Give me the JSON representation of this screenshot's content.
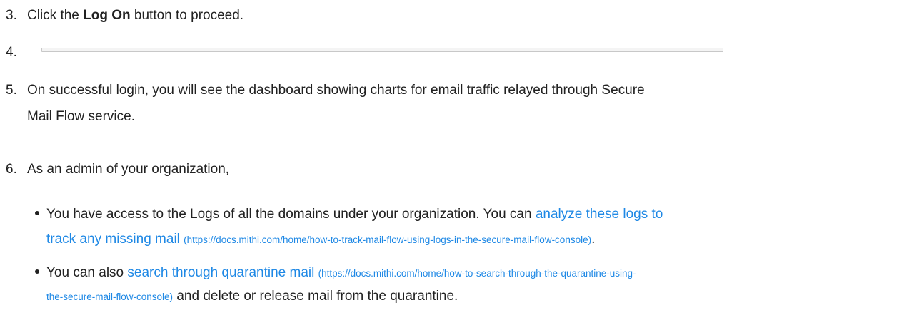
{
  "steps": [
    {
      "number": "3.",
      "text_before": "Click the ",
      "bold": "Log On",
      "text_after": " button to proceed."
    },
    {
      "number": "4."
    },
    {
      "number": "5.",
      "line1": "On successful login, you will see the dashboard showing charts for email traffic relayed through Secure",
      "line2": "Mail Flow service."
    },
    {
      "number": "6.",
      "text": "As an admin of your organization,"
    }
  ],
  "bullets": [
    {
      "text_before": "You have access to the Logs of all the domains under your organization. You can ",
      "link_line1": "analyze these logs to",
      "link_line2": "track any missing mail",
      "url": "(https://docs.mithi.com/home/how-to-track-mail-flow-using-logs-in-the-secure-mail-flow-console)",
      "text_after": "."
    },
    {
      "text_before": "You can also ",
      "link": "search through quarantine mail",
      "url_line1": "(https://docs.mithi.com/home/how-to-search-through-the-quarantine-using-",
      "url_line2": "the-secure-mail-flow-console)",
      "text_after": " and delete or release mail from the quarantine."
    }
  ]
}
